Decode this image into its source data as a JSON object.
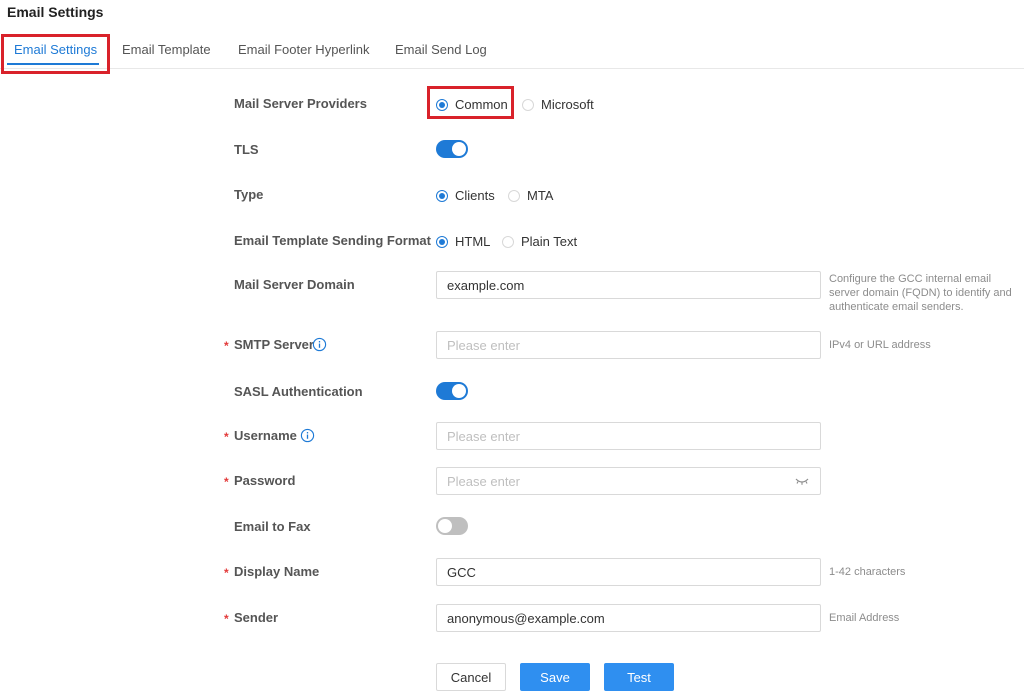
{
  "header": {
    "title": "Email Settings"
  },
  "tabs": [
    {
      "label": "Email Settings",
      "active": true
    },
    {
      "label": "Email Template",
      "active": false
    },
    {
      "label": "Email Footer Hyperlink",
      "active": false
    },
    {
      "label": "Email Send Log",
      "active": false
    }
  ],
  "form": {
    "mail_server_providers": {
      "label": "Mail Server Providers",
      "options": [
        "Common",
        "Microsoft"
      ],
      "selected": "Common"
    },
    "tls": {
      "label": "TLS",
      "enabled": true
    },
    "type": {
      "label": "Type",
      "options": [
        "Clients",
        "MTA"
      ],
      "selected": "Clients"
    },
    "sending_format": {
      "label": "Email Template Sending Format",
      "options": [
        "HTML",
        "Plain Text"
      ],
      "selected": "HTML"
    },
    "mail_server_domain": {
      "label": "Mail Server Domain",
      "value": "example.com",
      "hint": "Configure the GCC internal email server domain (FQDN) to identify and authenticate email senders."
    },
    "smtp_server": {
      "label": "SMTP Server",
      "required": "*",
      "value": "",
      "placeholder": "Please enter",
      "hint": "IPv4 or URL address"
    },
    "sasl_authentication": {
      "label": "SASL Authentication",
      "enabled": true
    },
    "username": {
      "label": "Username",
      "required": "*",
      "value": "",
      "placeholder": "Please enter"
    },
    "password": {
      "label": "Password",
      "required": "*",
      "value": "",
      "placeholder": "Please enter"
    },
    "email_to_fax": {
      "label": "Email to Fax",
      "enabled": false
    },
    "display_name": {
      "label": "Display Name",
      "required": "*",
      "value": "GCC",
      "hint": "1-42 characters"
    },
    "sender": {
      "label": "Sender",
      "required": "*",
      "value": "anonymous@example.com",
      "hint": "Email Address"
    }
  },
  "actions": {
    "cancel": "Cancel",
    "save": "Save",
    "test": "Test"
  },
  "colors": {
    "accent": "#1e7ad6",
    "primary_button": "#2f8ff0",
    "highlight": "#d9222a",
    "required": "#e33a3a"
  },
  "icons": {
    "info": "info-circle-icon",
    "password_toggle": "eye-closed-icon"
  }
}
